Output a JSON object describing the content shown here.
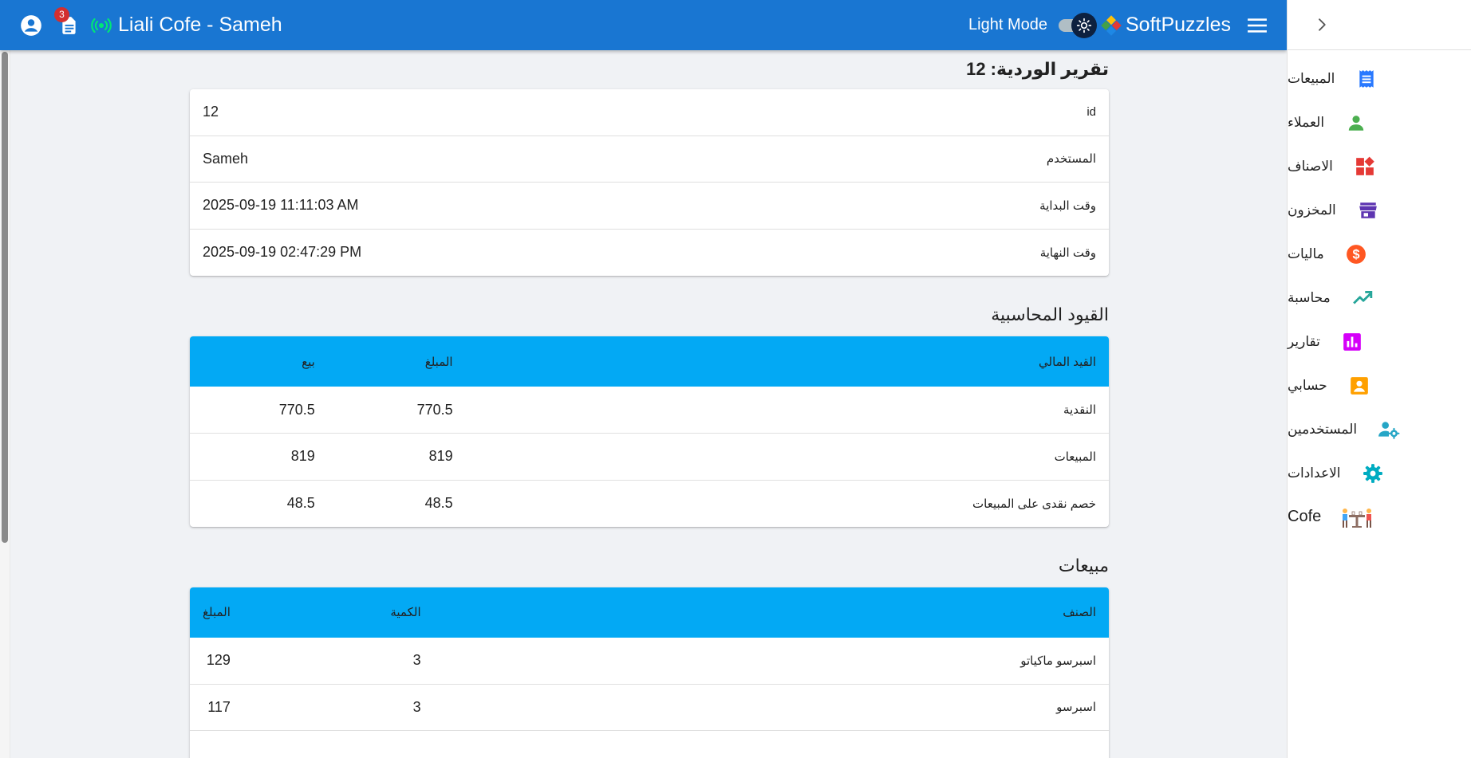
{
  "header": {
    "notification_count": "3",
    "app_title": "Liali Cofe - Sameh",
    "mode_label": "Light Mode",
    "brand_name": "SoftPuzzles"
  },
  "drawer": {
    "items": [
      {
        "label": "المبيعات",
        "icon": "receipt-icon",
        "color": "#2979ff"
      },
      {
        "label": "العملاء",
        "icon": "person-icon",
        "color": "#4caf50"
      },
      {
        "label": "الاصناف",
        "icon": "widgets-icon",
        "color": "#e53935"
      },
      {
        "label": "المخزون",
        "icon": "store-icon",
        "color": "#5e35b1"
      },
      {
        "label": "ماليات",
        "icon": "dollar-icon",
        "color": "#ff5722"
      },
      {
        "label": "محاسبة",
        "icon": "trending-up-icon",
        "color": "#26a69a"
      },
      {
        "label": "تقارير",
        "icon": "bar-chart-icon",
        "color": "#d500f9"
      },
      {
        "label": "حسابي",
        "icon": "account-box-icon",
        "color": "#ffa000"
      },
      {
        "label": "المستخدمين",
        "icon": "manage-accounts-icon",
        "color": "#26a6c6"
      },
      {
        "label": "الاعدادات",
        "icon": "gear-icon",
        "color": "#00acc1"
      },
      {
        "label": "Cofe",
        "icon": "cafe-table-icon",
        "color": "#8d6e63"
      }
    ]
  },
  "shift": {
    "title": "تقرير الوردية: 12",
    "rows": [
      {
        "key": "id",
        "value": "12"
      },
      {
        "key": "المستخدم",
        "value": "Sameh"
      },
      {
        "key": "وقت البداية",
        "value": "2025-09-19 11:11:03 AM"
      },
      {
        "key": "وقت النهاية",
        "value": "2025-09-19 02:47:29 PM"
      }
    ]
  },
  "journal": {
    "title": "القيود المحاسبية",
    "headers": [
      "القيد المالي",
      "المبلغ",
      "بيع"
    ],
    "rows": [
      [
        "النقدية",
        "770.5",
        "770.5"
      ],
      [
        "المبيعات",
        "819",
        "819"
      ],
      [
        "خصم نقدى على المبيعات",
        "48.5",
        "48.5"
      ]
    ]
  },
  "sales": {
    "title": "مبيعات",
    "headers": [
      "الصنف",
      "الكمية",
      "المبلغ"
    ],
    "rows": [
      [
        "اسبرسو ماكياتو",
        "3",
        "129"
      ],
      [
        "اسبرسو",
        "3",
        "117"
      ]
    ]
  },
  "colors": {
    "appbar": "#1976d2",
    "table_header": "#03a9f4",
    "online": "#00e676"
  }
}
